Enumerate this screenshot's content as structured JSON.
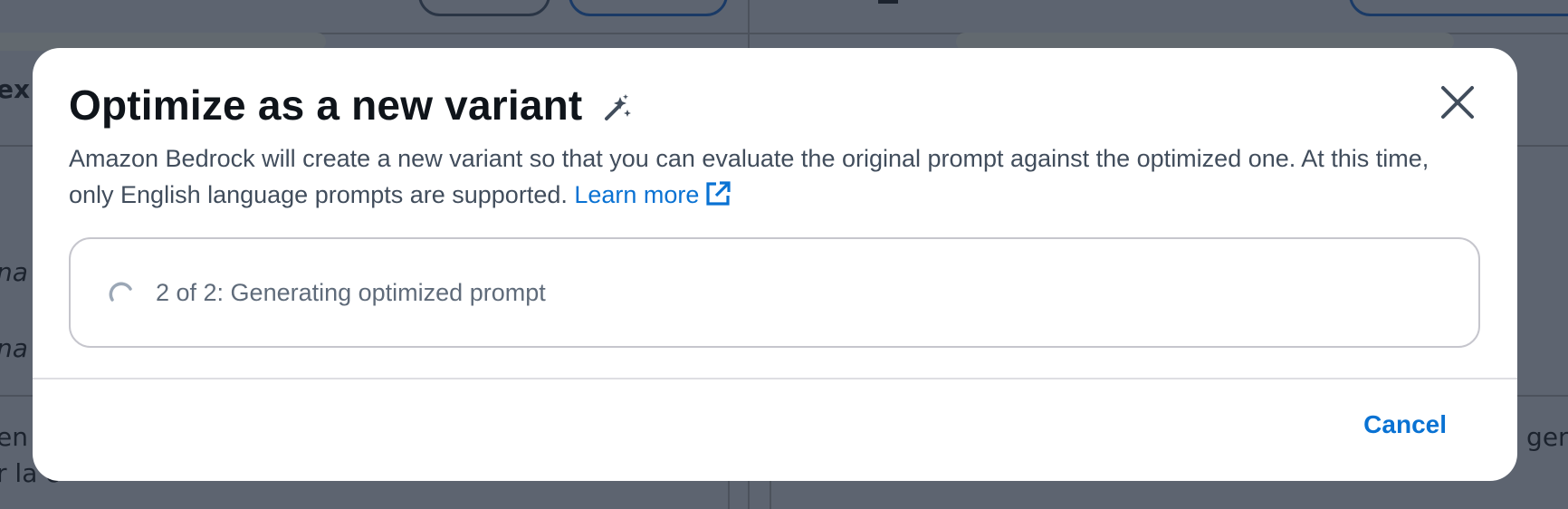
{
  "modal": {
    "title": "Optimize as a new variant",
    "description": "Amazon Bedrock will create a new variant so that you can evaluate the original prompt against the optimized one. At this time, only English language prompts are supported.",
    "learn_more_label": "Learn more",
    "progress_text": "2 of 2: Generating optimized prompt",
    "cancel_label": "Cancel",
    "close_aria_label": "Close modal"
  },
  "background": {
    "left_partial_texts": [
      "ex",
      "na",
      "na",
      "en",
      "r la c"
    ],
    "right_partial_text": "a gen"
  },
  "colors": {
    "overlay": "#5d6470",
    "link": "#0972d3",
    "title": "#0f141a",
    "body_text": "#414d5c",
    "muted_text": "#5f6b7a",
    "border": "#c6c6cd"
  },
  "icons": {
    "title_icon": "magic-wand-icon",
    "external_link_icon": "external-link-icon",
    "close_icon": "close-icon",
    "loading_icon": "spinner-icon"
  }
}
